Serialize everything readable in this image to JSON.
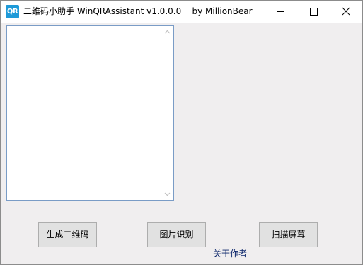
{
  "window": {
    "title": "二维码小助手 WinQRAssistant v1.0.0.0    by MillionBear",
    "icon_text": "QR",
    "icon": "qr-app-icon",
    "accent": "#1e9ad8",
    "controls": {
      "minimize_icon": "minimize-icon",
      "maximize_icon": "maximize-icon",
      "close_icon": "close-icon"
    }
  },
  "main": {
    "text_area": {
      "value": ""
    },
    "buttons": {
      "generate": "生成二维码",
      "recognize": "图片识别",
      "scan_screen": "扫描屏幕"
    },
    "about_link": "关于作者"
  }
}
